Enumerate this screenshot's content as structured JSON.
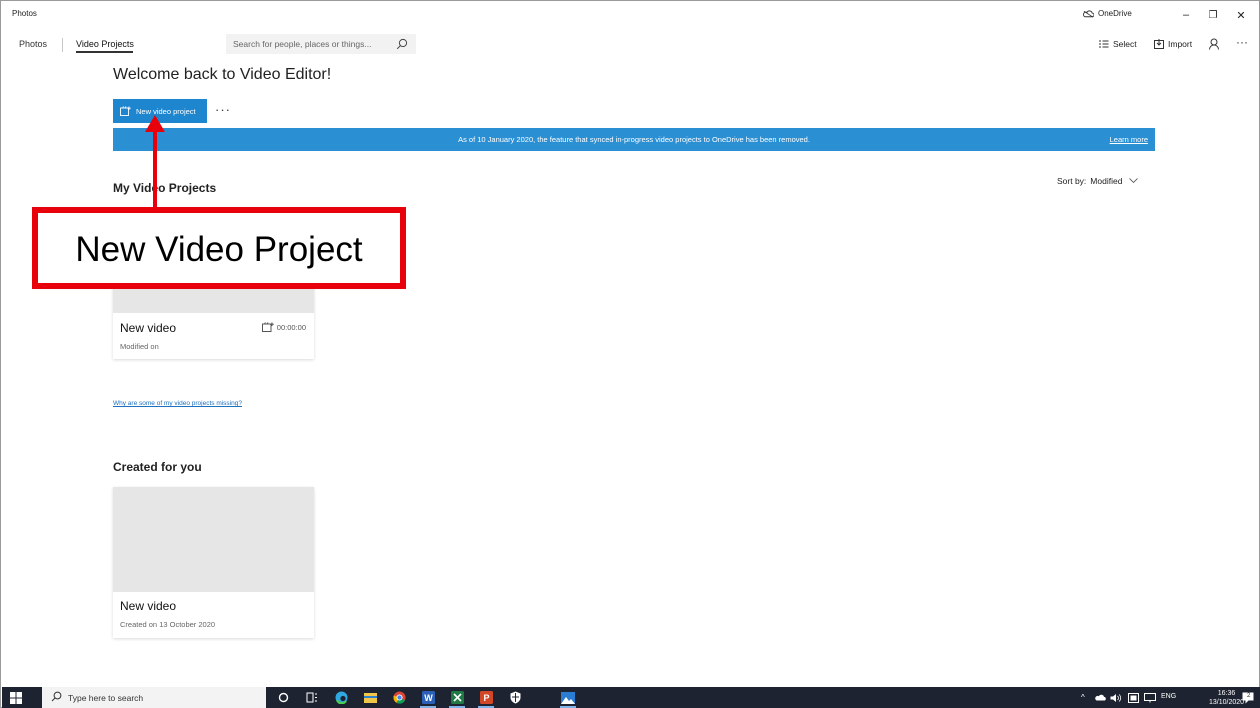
{
  "window": {
    "app_title": "Photos",
    "onedrive_label": "OneDrive",
    "controls": {
      "minimize": "–",
      "restore": "❐",
      "close": "✕"
    }
  },
  "nav": {
    "photos_label": "Photos",
    "video_projects_label": "Video Projects",
    "search_placeholder": "Search for people, places or things...",
    "select_label": "Select",
    "import_label": "Import",
    "more_label": "···"
  },
  "main": {
    "welcome_heading": "Welcome back to Video Editor!",
    "new_project_button": "New video project",
    "more_button": "···",
    "banner_text": "As of 10 January 2020, the feature that synced in-progress video projects to OneDrive has been removed.",
    "banner_link": "Learn more",
    "my_projects_title": "My Video Projects",
    "sort_label": "Sort by:",
    "sort_value": "Modified",
    "project_card": {
      "title": "New video",
      "subtitle": "Modified on",
      "duration": "00:00:00"
    },
    "missing_link": "Why are some of my video projects missing?",
    "created_title": "Created for you",
    "created_card": {
      "title": "New video",
      "subtitle": "Created on 13 October 2020"
    }
  },
  "annotation": {
    "label": "New Video Project",
    "color": "#e8000b"
  },
  "taskbar": {
    "search_placeholder": "Type here to search",
    "apps": [
      "cortana-icon",
      "task-view-icon",
      "edge-icon",
      "file-explorer-icon",
      "chrome-icon",
      "word-icon",
      "excel-icon",
      "powerpoint-icon",
      "security-icon",
      "photos-icon"
    ],
    "language": "ENG",
    "time": "16:36",
    "date": "13/10/2020",
    "notification_count": "2"
  },
  "colors": {
    "accent": "#1d86cf",
    "banner": "#2b8fd3",
    "taskbar": "#1d2330"
  }
}
